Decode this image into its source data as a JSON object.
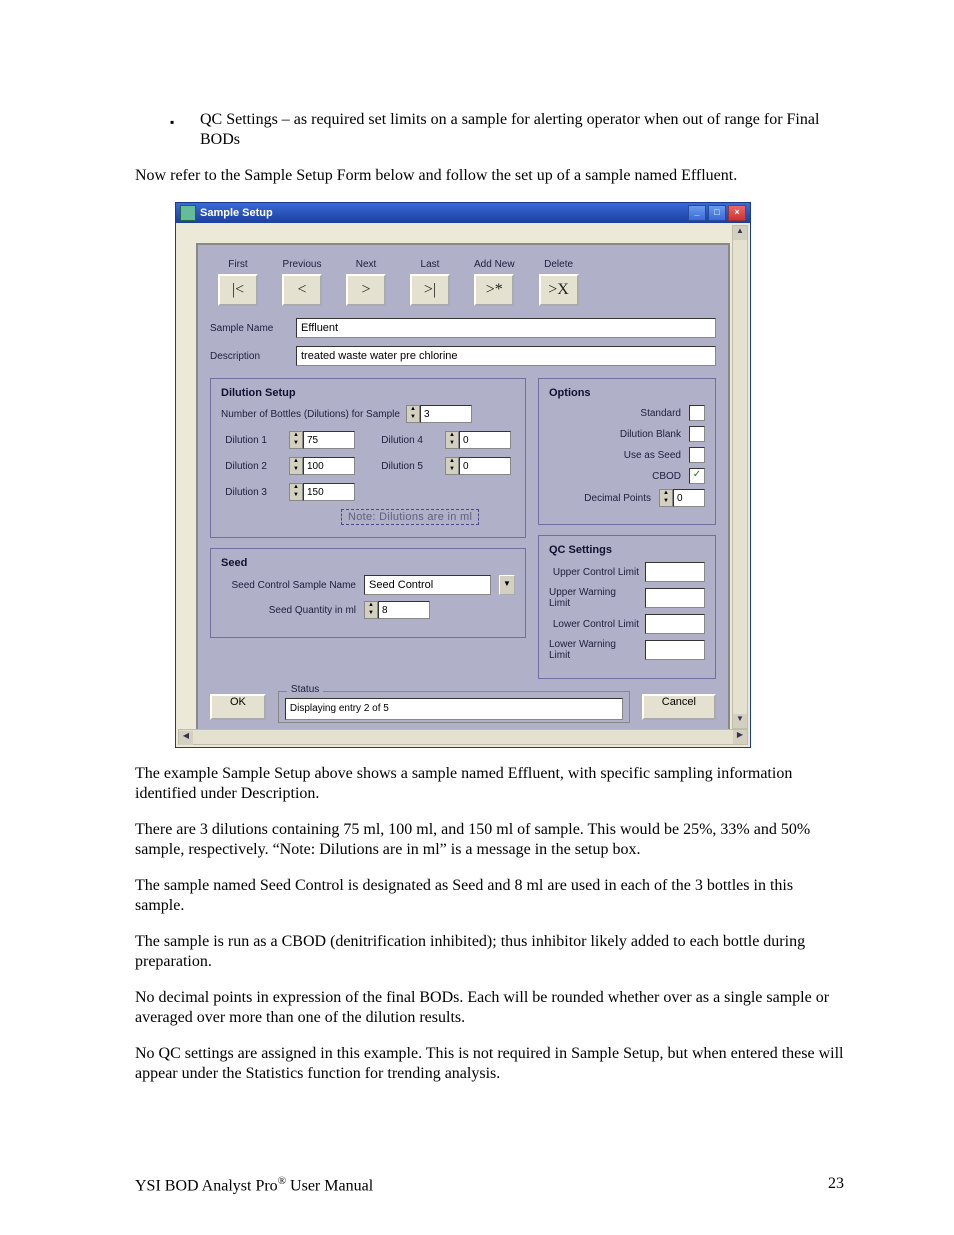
{
  "bullet": "QC Settings – as required set limits on a sample for alerting operator when out of range for Final BODs",
  "intro": "Now refer to the Sample Setup Form below and follow the set up of a sample named Effluent.",
  "screenshot": {
    "title": "Sample Setup",
    "nav": [
      {
        "label": "First",
        "glyph": "|<"
      },
      {
        "label": "Previous",
        "glyph": "<"
      },
      {
        "label": "Next",
        "glyph": ">"
      },
      {
        "label": "Last",
        "glyph": ">|"
      },
      {
        "label": "Add New",
        "glyph": ">*"
      },
      {
        "label": "Delete",
        "glyph": ">X"
      }
    ],
    "sample_name_label": "Sample Name",
    "sample_name_value": "Effluent",
    "description_label": "Description",
    "description_value": "treated waste water pre chlorine",
    "dilution": {
      "title": "Dilution Setup",
      "num_bottles_label": "Number of Bottles (Dilutions) for Sample",
      "num_bottles": "3",
      "rows": [
        {
          "l": "Dilution 1",
          "v": "75"
        },
        {
          "l": "Dilution 2",
          "v": "100"
        },
        {
          "l": "Dilution 3",
          "v": "150"
        },
        {
          "l": "Dilution 4",
          "v": "0"
        },
        {
          "l": "Dilution 5",
          "v": "0"
        }
      ],
      "note": "Note: Dilutions are in ml"
    },
    "options": {
      "title": "Options",
      "standard": "Standard",
      "blank": "Dilution Blank",
      "seed": "Use as Seed",
      "cbod": "CBOD",
      "decpts": "Decimal Points",
      "decpts_val": "0"
    },
    "qc": {
      "title": "QC Settings",
      "ucl": "Upper Control Limit",
      "uwl": "Upper Warning Limit",
      "lcl": "Lower Control Limit",
      "lwl": "Lower Warning Limit"
    },
    "seed": {
      "title": "Seed",
      "name_label": "Seed Control Sample Name",
      "name_value": "Seed Control",
      "qty_label": "Seed Quantity in ml",
      "qty_value": "8"
    },
    "ok": "OK",
    "cancel": "Cancel",
    "status_label": "Status",
    "status_value": "Displaying entry 2 of 5"
  },
  "p1": "The example Sample Setup above shows a sample named Effluent, with specific sampling information identified under Description.",
  "p2": "There are 3 dilutions containing 75 ml, 100 ml, and 150 ml of sample. This would be 25%, 33% and 50% sample, respectively. “Note: Dilutions are in ml” is a message in the setup box.",
  "p3": "The sample named Seed Control is designated as Seed and 8 ml are used in each of the 3 bottles in this sample.",
  "p4": "The sample is run as a CBOD (denitrification inhibited); thus inhibitor likely added to each bottle during preparation.",
  "p5": "No decimal points in expression of the final BODs. Each will be rounded whether over as a single sample or averaged over more than one of the dilution results.",
  "p6": "No QC settings are assigned in this example. This is not required in Sample Setup, but when entered these will appear under the Statistics function for trending analysis.",
  "footer_left": "YSI BOD Analyst Pro",
  "footer_reg": "®",
  "footer_left2": " User Manual",
  "footer_right": "23"
}
